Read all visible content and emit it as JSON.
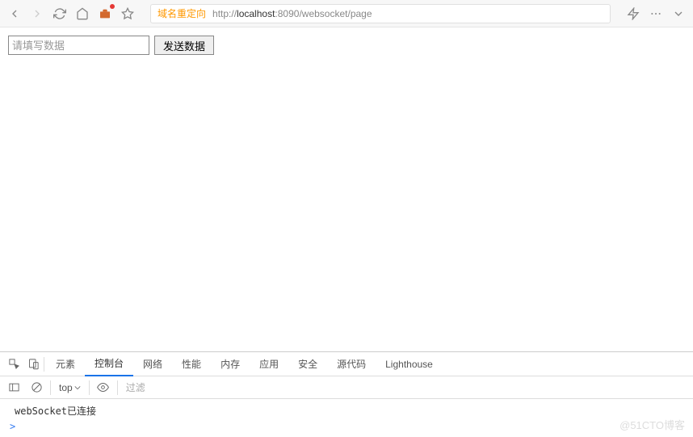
{
  "toolbar": {
    "redirect_label": "域名重定向",
    "url_prefix": "http://",
    "url_host": "localhost",
    "url_rest": ":8090/websocket/page"
  },
  "page": {
    "input_placeholder": "请填写数据",
    "send_button": "发送数据"
  },
  "devtools": {
    "tabs": [
      "元素",
      "控制台",
      "网络",
      "性能",
      "内存",
      "应用",
      "安全",
      "源代码",
      "Lighthouse"
    ],
    "active_tab_index": 1,
    "context": "top",
    "filter_placeholder": "过滤",
    "console_message": "webSocket已连接",
    "prompt": ">"
  },
  "watermark": "@51CTO博客"
}
